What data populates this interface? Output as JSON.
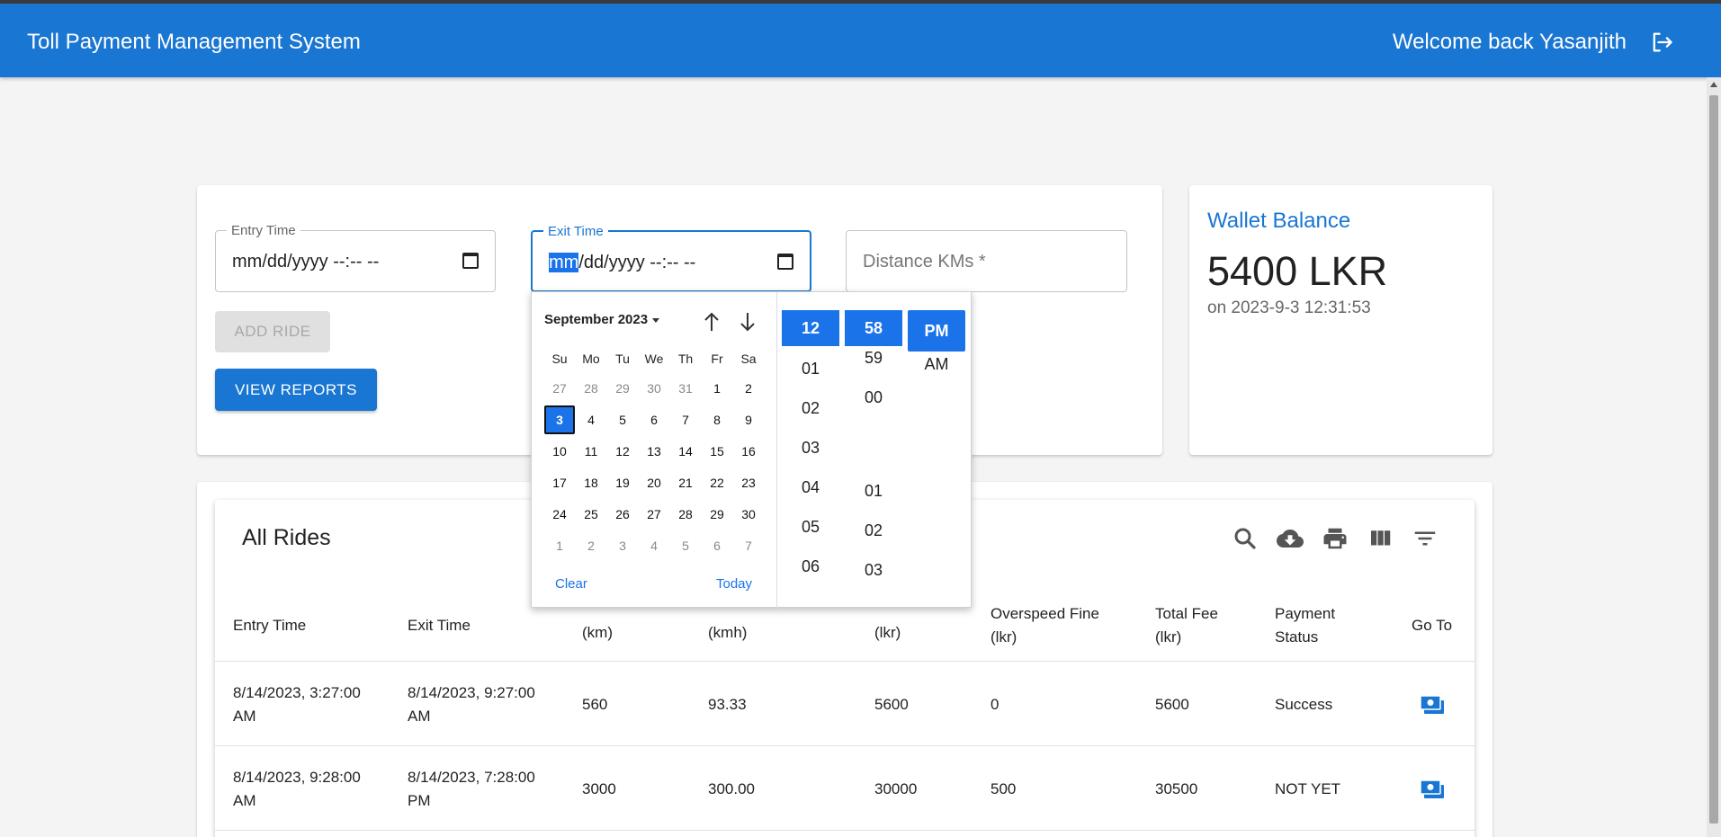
{
  "header": {
    "title": "Toll Payment Management System",
    "welcome": "Welcome back Yasanjith"
  },
  "form": {
    "entry_label": "Entry Time",
    "entry_value": "mm/dd/yyyy --:-- --",
    "exit_label": "Exit Time",
    "exit_value_hl": "mm",
    "exit_value_rest": "/dd/yyyy --:-- --",
    "distance_placeholder": "Distance KMs *",
    "add_ride": "ADD RIDE",
    "view_reports": "VIEW REPORTS"
  },
  "wallet": {
    "title": "Wallet Balance",
    "amount": "5400 LKR",
    "date": "on 2023-9-3 12:31:53"
  },
  "picker": {
    "month": "September 2023",
    "weekdays": [
      "Su",
      "Mo",
      "Tu",
      "We",
      "Th",
      "Fr",
      "Sa"
    ],
    "weeks": [
      [
        "27",
        "28",
        "29",
        "30",
        "31",
        "1",
        "2"
      ],
      [
        "3",
        "4",
        "5",
        "6",
        "7",
        "8",
        "9"
      ],
      [
        "10",
        "11",
        "12",
        "13",
        "14",
        "15",
        "16"
      ],
      [
        "17",
        "18",
        "19",
        "20",
        "21",
        "22",
        "23"
      ],
      [
        "24",
        "25",
        "26",
        "27",
        "28",
        "29",
        "30"
      ],
      [
        "1",
        "2",
        "3",
        "4",
        "5",
        "6",
        "7"
      ]
    ],
    "selected_day": "3",
    "clear": "Clear",
    "today": "Today",
    "hours": [
      "12",
      "01",
      "02",
      "03",
      "04",
      "05",
      "06"
    ],
    "minutes": [
      "58",
      "59",
      "00",
      "",
      "01",
      "02",
      "03"
    ],
    "ampm": [
      "PM",
      "AM"
    ]
  },
  "table": {
    "title": "All Rides",
    "headers": [
      [
        "Entry Time"
      ],
      [
        "Exit Time"
      ],
      [
        "(km)"
      ],
      [
        "(kmh)"
      ],
      [
        "(lkr)"
      ],
      [
        "Overspeed Fine",
        "(lkr)"
      ],
      [
        "Total Fee",
        "(lkr)"
      ],
      [
        "Payment",
        "Status"
      ],
      [
        "Go To"
      ]
    ],
    "rows": [
      [
        "8/14/2023, 3:27:00 AM",
        "8/14/2023, 9:27:00 AM",
        "560",
        "93.33",
        "5600",
        "0",
        "5600",
        "Success"
      ],
      [
        "8/14/2023, 9:28:00 AM",
        "8/14/2023, 7:28:00 PM",
        "3000",
        "300.00",
        "30000",
        "500",
        "30500",
        "NOT YET"
      ]
    ]
  },
  "colors": {
    "primary": "#1976d2",
    "picker_selected": "#1a73e8"
  }
}
